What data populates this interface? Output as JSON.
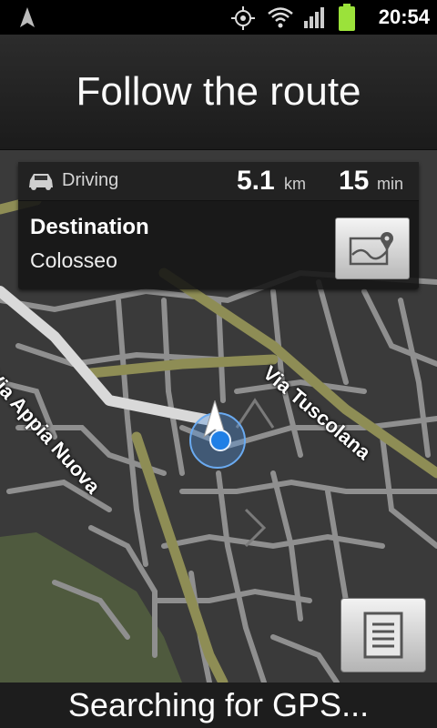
{
  "status_bar": {
    "time": "20:54",
    "icons": [
      "navigation-arrow-icon",
      "gps-icon",
      "wifi-icon",
      "signal-icon",
      "battery-icon"
    ]
  },
  "header": {
    "title": "Follow the route"
  },
  "trip": {
    "mode": "Driving",
    "distance_value": "5.1",
    "distance_unit": "km",
    "time_value": "15",
    "time_unit": "min"
  },
  "destination": {
    "heading": "Destination",
    "name": "Colosseo"
  },
  "map": {
    "road_labels": [
      "Via Appia Nuova",
      "Via Tuscolana"
    ],
    "colors": {
      "background": "#3a3a3a",
      "street": "#8f8f8f",
      "major_road": "#8e8d55",
      "route": "#d9d9d9",
      "park": "#4f5a3e",
      "marker": "#1f7fe6"
    }
  },
  "footer": {
    "status": "Searching for GPS..."
  }
}
